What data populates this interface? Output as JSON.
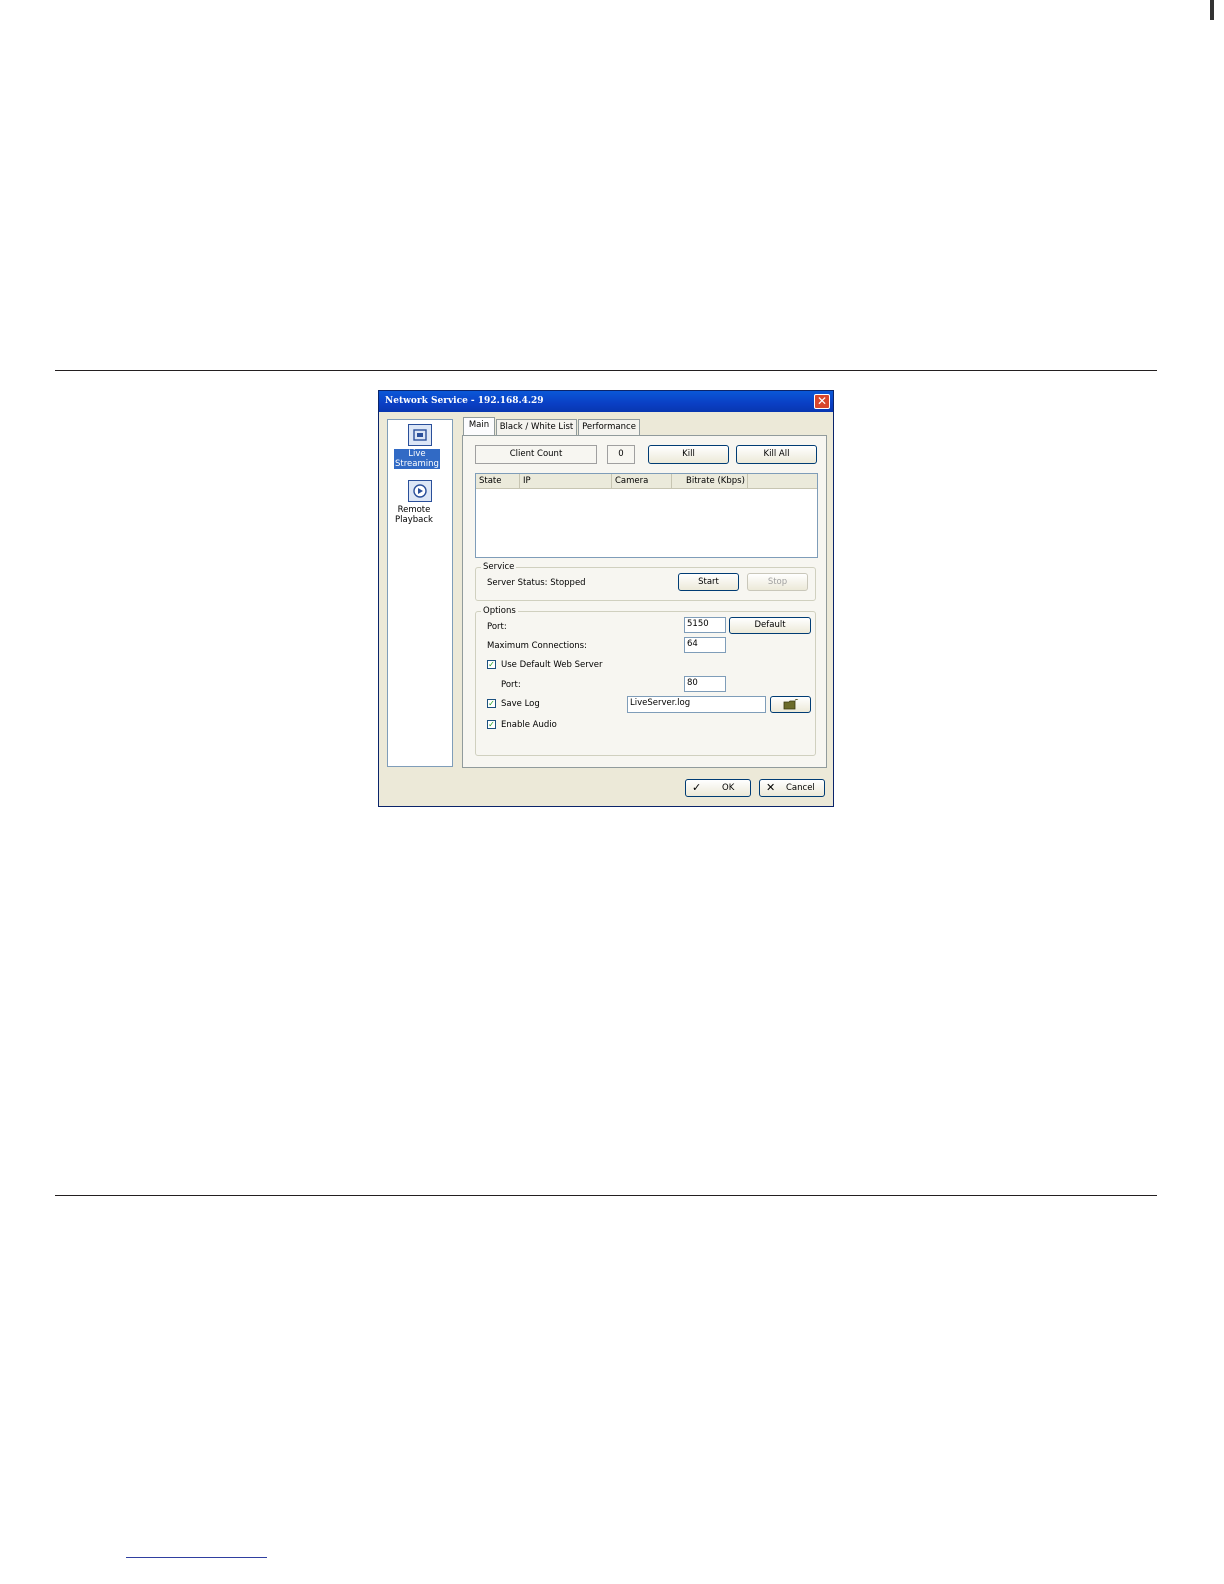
{
  "window": {
    "title": "Network Service - 192.168.4.29"
  },
  "sidebar": {
    "items": [
      {
        "label_line1": "Live",
        "label_line2": "Streaming",
        "icon": "live-streaming-icon",
        "selected": true
      },
      {
        "label_line1": "Remote",
        "label_line2": "Playback",
        "icon": "remote-playback-icon",
        "selected": false
      }
    ]
  },
  "tabs": [
    {
      "label": "Main",
      "active": true
    },
    {
      "label": "Black / White List",
      "active": false
    },
    {
      "label": "Performance",
      "active": false
    }
  ],
  "main": {
    "client_count_label": "Client Count",
    "client_count_value": "0",
    "kill_label": "Kill",
    "kill_all_label": "Kill All",
    "list_columns": [
      "State",
      "IP",
      "Camera",
      "Bitrate (Kbps)"
    ],
    "list_rows": []
  },
  "service": {
    "group_label": "Service",
    "status_text": "Server Status: Stopped",
    "start_label": "Start",
    "stop_label": "Stop"
  },
  "options": {
    "group_label": "Options",
    "port_label": "Port:",
    "port_value": "5150",
    "default_label": "Default",
    "max_conn_label": "Maximum Connections:",
    "max_conn_value": "64",
    "use_default_web_label": "Use Default Web Server",
    "use_default_web_checked": true,
    "web_port_label": "Port:",
    "web_port_value": "80",
    "save_log_label": "Save Log",
    "save_log_checked": true,
    "log_file_value": "LiveServer.log",
    "enable_audio_label": "Enable Audio",
    "enable_audio_checked": true
  },
  "footer": {
    "ok_label": "OK",
    "cancel_label": "Cancel"
  },
  "colors": {
    "titlebar": "#0a46cc",
    "dialog_bg": "#ece9d8",
    "selection": "#316ac5"
  }
}
